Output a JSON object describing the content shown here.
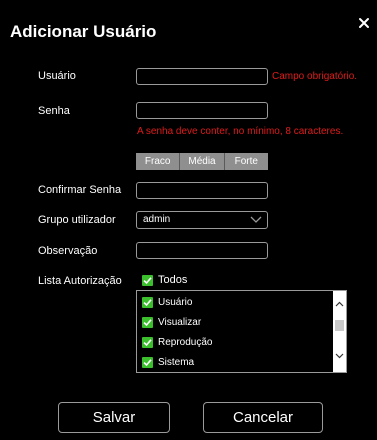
{
  "dialog": {
    "title": "Adicionar Usuário",
    "close_icon": "close-icon"
  },
  "form": {
    "username": {
      "label": "Usuário",
      "value": "",
      "error": "Campo obrigatório."
    },
    "password": {
      "label": "Senha",
      "value": "",
      "error": "A senha deve conter, no mínimo, 8 caracteres."
    },
    "strength": [
      "Fraco",
      "Média",
      "Forte"
    ],
    "confirm": {
      "label": "Confirmar Senha",
      "value": ""
    },
    "group": {
      "label": "Grupo utilizador",
      "selected": "admin"
    },
    "note": {
      "label": "Observação",
      "value": ""
    },
    "auth": {
      "label": "Lista Autorização",
      "all_label": "Todos",
      "items": [
        "Usuário",
        "Visualizar",
        "Reprodução",
        "Sistema"
      ]
    }
  },
  "buttons": {
    "save": "Salvar",
    "cancel": "Cancelar"
  },
  "colors": {
    "background": "#000000",
    "error": "#e01b1b",
    "check": "#3bbf2c",
    "strength": "#8f8f8f"
  }
}
